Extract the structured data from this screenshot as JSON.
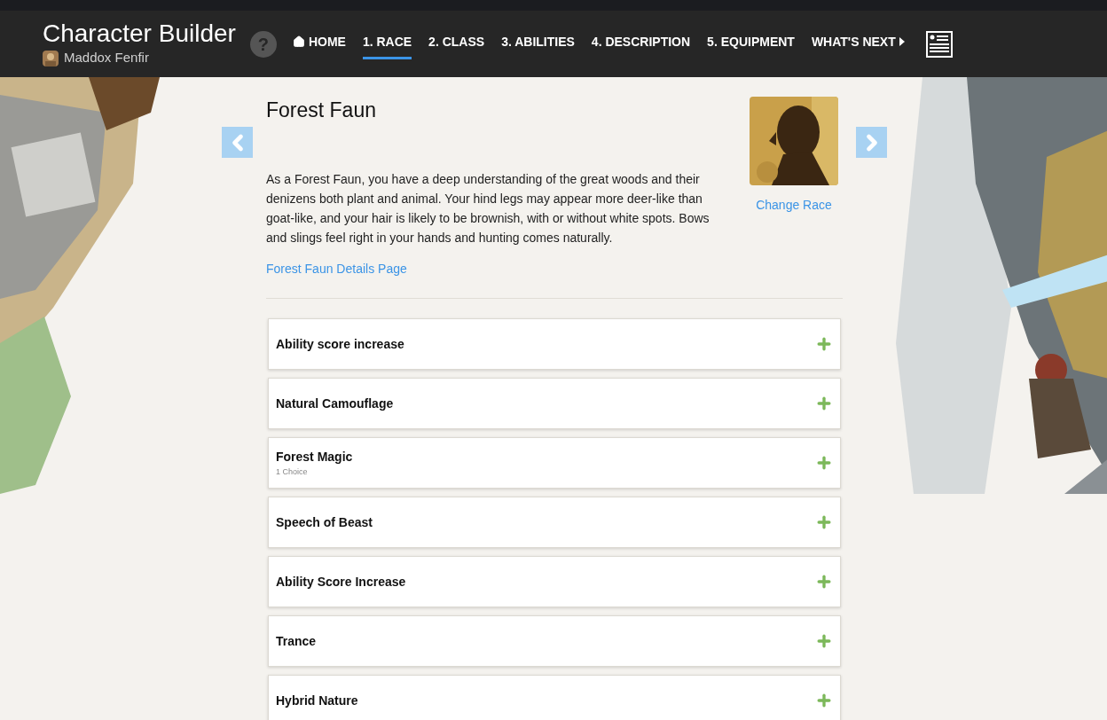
{
  "header": {
    "title": "Character Builder",
    "character_name": "Maddox Fenfir",
    "help": "?"
  },
  "nav": [
    {
      "label": "HOME",
      "kind": "home",
      "selected": false
    },
    {
      "label": "1. RACE",
      "kind": "step",
      "selected": true
    },
    {
      "label": "2. CLASS",
      "kind": "step",
      "selected": false
    },
    {
      "label": "3. ABILITIES",
      "kind": "step",
      "selected": false
    },
    {
      "label": "4. DESCRIPTION",
      "kind": "step",
      "selected": false
    },
    {
      "label": "5. EQUIPMENT",
      "kind": "step",
      "selected": false
    },
    {
      "label": "WHAT'S NEXT",
      "kind": "next",
      "selected": false
    }
  ],
  "race": {
    "name": "Forest Faun",
    "description": "As a Forest Faun, you have a deep understanding of the great woods and their denizens both plant and animal. Your hind legs may appear more deer-like than goat-like, and your hair is likely to be brownish, with or without white spots. Bows and slings feel right in your hands and hunting comes naturally.",
    "details_link": "Forest Faun Details Page",
    "change_link": "Change Race"
  },
  "traits": [
    {
      "title": "Ability score increase",
      "expanded": false
    },
    {
      "title": "Natural Camouflage",
      "expanded": false
    },
    {
      "title": "Forest Magic",
      "subtitle": "1 Choice",
      "expanded": false
    },
    {
      "title": "Speech of Beast",
      "expanded": false
    },
    {
      "title": "Ability Score Increase",
      "expanded": false
    },
    {
      "title": "Trance",
      "expanded": false
    },
    {
      "title": "Hybrid Nature",
      "expanded": false
    }
  ]
}
